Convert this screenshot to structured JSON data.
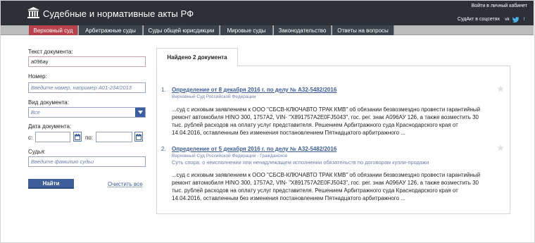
{
  "header": {
    "title": "Судебные и нормативные акты РФ",
    "login": "Войти в личный кабинет",
    "social_label": "СудАкт в соцсетях",
    "social": [
      "vk",
      "tw",
      "f"
    ]
  },
  "nav": {
    "tabs": [
      {
        "label": "Верховный суд",
        "active": true
      },
      {
        "label": "Арбитражные суды"
      },
      {
        "label": "Суды общей юрисдикции"
      },
      {
        "label": "Мировые суды"
      },
      {
        "label": "Законодательство"
      },
      {
        "label": "Ответы на вопросы"
      }
    ]
  },
  "form": {
    "doc_text_label": "Текст документа:",
    "doc_text_value": "а096ау",
    "number_label": "Номер:",
    "number_placeholder": "Введите номер, например А01-234/2013",
    "doc_type_label": "Вид документа:",
    "doc_type_value": "Все",
    "date_label": "Дата документа:",
    "date_from_label": "с:",
    "date_to_label": "по:",
    "judge_label": "Судья:",
    "judge_placeholder": "Введите фамилию судьи",
    "search_button": "Найти",
    "clear_link": "Очистить все"
  },
  "results": {
    "found": "Найдено 2 документа",
    "items": [
      {
        "num": "1.",
        "title": "Определение от 8 декабря 2016 г. по делу № А32-5482/2016",
        "court": "Верховный Суд Российской Федерации",
        "subject": "",
        "lines": [
          "...суд с исковым заявлением к ООО \"СБСВ-КЛЮЧАВТО ТРАК КМВ\" об обязании безвозмездно провести гарантийный",
          "ремонт автомобиля HINO 300, 1757A2, VIN- \"X891757A2E0FJ5043\", гос. рег. знак А096АУ 126, а также возместить 30",
          "тыс. рублей расходов на оплату услуг представителя. Решением Арбитражного суда Краснодарского края от",
          "14.04.2016, оставленным без изменения постановлением Пятнадцатого арбитражного ..."
        ]
      },
      {
        "num": "2.",
        "title": "Определение от 5 декабря 2016 г. по делу № А32-5482/2016",
        "court": "Верховный Суд Российской Федерации - Гражданское",
        "subject": "Суть спора: о неисполнении или ненадлежащем исполнении обязательств по договорам купли-продажи",
        "lines": [
          "...суд с исковым заявлением к ООО \"СБСВ-КЛЮЧАВТО ТРАК КМВ\" об обязании безвозмездно провести гарантийный",
          "ремонт автомобиля HINO 300, 1757A2, VIN- \"X891757A2E0FJ5043\", гос. рег. знак А096АУ 126, а также возместить 30",
          "тыс. рублей расходов на оплату услуг представителя. Решением Арбитражного суда Краснодарского края от",
          "14.04.2016, оставленным без изменения постановлением Пятнадцатого арбитражного ..."
        ]
      }
    ]
  },
  "colors": {
    "header_bg": "#2d3036",
    "tab_bg": "#3c434d",
    "tab_active": "#b8424b",
    "link": "#3d5e99"
  }
}
